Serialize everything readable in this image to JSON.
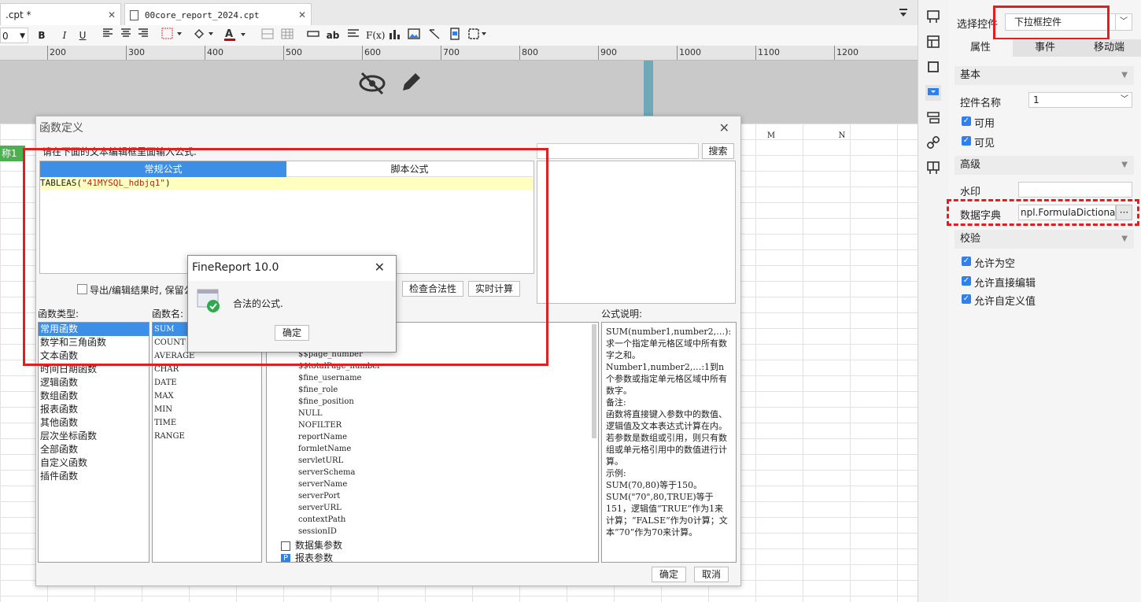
{
  "tabs": [
    {
      "label": ".cpt *",
      "close": "✕"
    },
    {
      "label": "00core_report_2024.cpt",
      "close": "✕"
    }
  ],
  "toolbar": {
    "font_size": "0",
    "bold": "B",
    "italic": "I",
    "underline": "U",
    "text_btn": "ab",
    "formula_btn": "F(x)"
  },
  "ruler": [
    "200",
    "300",
    "400",
    "500",
    "600",
    "700",
    "800",
    "900",
    "1000",
    "1100",
    "1200"
  ],
  "sheet": {
    "col_m": "M",
    "col_n": "N",
    "header_cell": "称1"
  },
  "right_panel": {
    "select_label": "选择控件",
    "select_value": "下拉框控件",
    "tabs": [
      "属性",
      "事件",
      "移动端"
    ],
    "basic_section": "基本",
    "widget_name_label": "控件名称",
    "widget_name_value": "1",
    "enabled_label": "可用",
    "visible_label": "可见",
    "advanced_section": "高级",
    "watermark_label": "水印",
    "watermark_value": "",
    "dict_label": "数据字典",
    "dict_value": "npl.FormulaDictionary",
    "dict_btn": "···",
    "validate_section": "校验",
    "allow_empty": "允许为空",
    "allow_edit": "允许直接编辑",
    "allow_custom": "允许自定义值"
  },
  "dialog": {
    "title": "函数定义",
    "close": "✕",
    "instruction": "请在下面的文本编辑框里面输入公式.",
    "search_btn": "搜索",
    "search_value": "",
    "mode_tabs": [
      "常规公式",
      "脚本公式"
    ],
    "formula_prefix": "TABLEAS(",
    "formula_arg": "\"41MYSQL_hdbjq1\"",
    "formula_suffix": ")",
    "export_checkbox": "导出/编辑结果时, 保留公式",
    "check_btn": "检查合法性",
    "realtime_btn": "实时计算",
    "func_type_label": "函数类型:",
    "func_name_label": "函数名:",
    "formula_desc_label": "公式说明:",
    "func_types": [
      "常用函数",
      "数学和三角函数",
      "文本函数",
      "时间日期函数",
      "逻辑函数",
      "数组函数",
      "报表函数",
      "其他函数",
      "层次坐标函数",
      "全部函数",
      "自定义函数",
      "插件函数"
    ],
    "func_names": [
      "SUM",
      "COUNT",
      "AVERAGE",
      "CHAR",
      "DATE",
      "MAX",
      "MIN",
      "TIME",
      "RANGE"
    ],
    "params": [
      "$$page_number",
      "$$totalPage_number",
      "$fine_username",
      "$fine_role",
      "$fine_position",
      "NULL",
      "NOFILTER",
      "reportName",
      "formletName",
      "servletURL",
      "serverSchema",
      "serverName",
      "serverPort",
      "serverURL",
      "contextPath",
      "sessionID"
    ],
    "dataset_params": "数据集参数",
    "report_params": "报表参数",
    "description": "SUM(number1,number2,…):求一个指定单元格区域中所有数字之和。\nNumber1,number2,…:1到n个参数或指定单元格区域中所有数字。\n备注:\n函数将直接键入参数中的数值、逻辑值及文本表达式计算在内。若参数是数组或引用，则只有数组或单元格引用中的数值进行计算。\n示例:\nSUM(70,80)等于150。\nSUM(\"70\",80,TRUE)等于151，逻辑值“TRUE”作为1来计算；“FALSE”作为0计算；文本“70”作为70来计算。",
    "ok_btn": "确定",
    "cancel_btn": "取消"
  },
  "message": {
    "title": "FineReport 10.0",
    "close": "✕",
    "text": "合法的公式.",
    "ok": "确定"
  },
  "colors": {
    "accent": "#3d8ee6",
    "highlight": "#e02020",
    "formula_bg": "#ffffc0",
    "header_green": "#4caf50"
  }
}
